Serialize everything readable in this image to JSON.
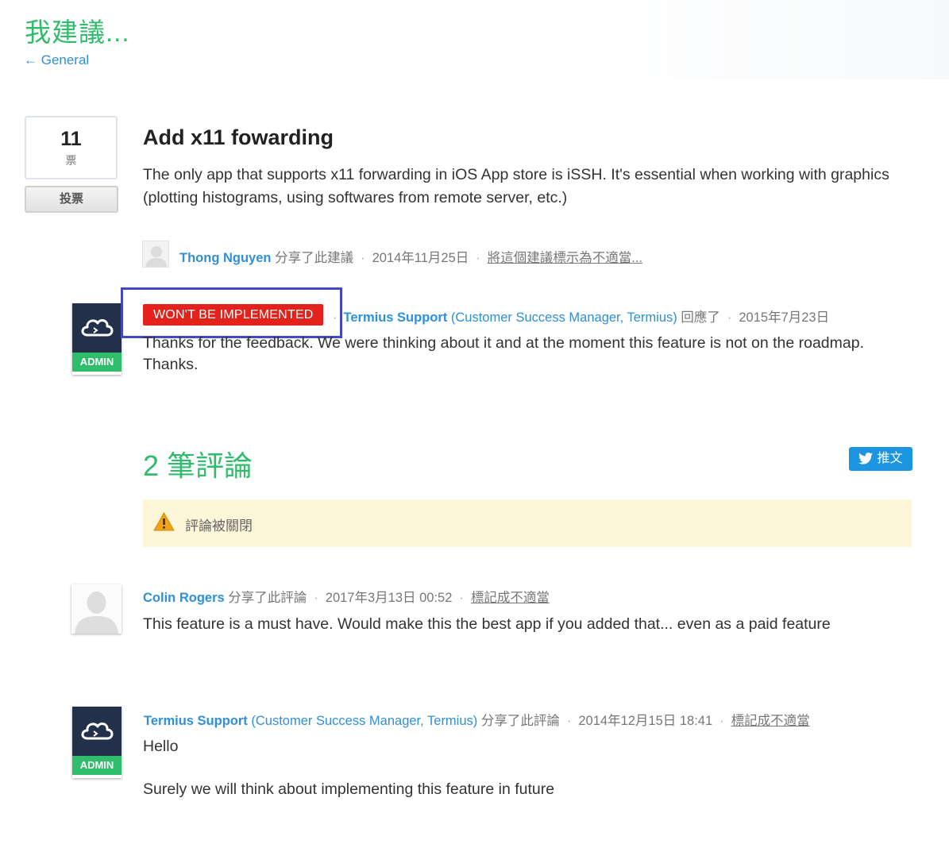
{
  "header": {
    "page_title": "我建議...",
    "back_link": "← General"
  },
  "idea": {
    "votes": "11",
    "votes_unit": "票",
    "vote_button": "投票",
    "title": "Add x11 fowarding",
    "body": "The only app that supports x11 forwarding in iOS App store is iSSH. It's essential when working with graphics (plotting histograms, using softwares from remote server, etc.)",
    "author": "Thong Nguyen",
    "shared_text": "分享了此建議",
    "date": "2014年11月25日",
    "flag_link": "將這個建議標示為不適當..."
  },
  "admin_response": {
    "status": "WON'T BE IMPLEMENTED",
    "author": "Termius Support",
    "role": "(Customer Success Manager, Termius)",
    "action": "回應了",
    "date": "2015年7月23日",
    "text": "Thanks for the feedback. We were thinking about it and at the moment this feature is not on the roadmap. Thanks.",
    "badge": "ADMIN"
  },
  "comments_section": {
    "heading": "2 筆評論",
    "tweet_label": "推文",
    "closed_notice": "評論被關閉"
  },
  "comments": [
    {
      "author": "Colin Rogers",
      "role": "",
      "shared_text": "分享了此評論",
      "date": "2017年3月13日 00:52",
      "flag": "標記成不適當",
      "text": [
        "This feature is a must have. Would make this the best app if you added that... even as a paid feature"
      ]
    },
    {
      "author": "Termius Support",
      "role": "(Customer Success Manager, Termius)",
      "shared_text": "分享了此評論",
      "date": "2014年12月15日 18:41",
      "flag": "標記成不適當",
      "badge": "ADMIN",
      "text": [
        "Hello",
        "Surely we will think about implementing this feature in future"
      ]
    }
  ],
  "colors": {
    "brand_green": "#2fbd6b",
    "link_blue": "#2f8fd8",
    "status_red": "#e3221c",
    "notice_bg": "#fdf6d8",
    "twitter_blue": "#1b95e0",
    "highlight": "#4148c2"
  },
  "icons": [
    "arrow-left-icon",
    "user-placeholder-icon",
    "termius-logo-icon",
    "warning-icon",
    "twitter-bird-icon"
  ]
}
